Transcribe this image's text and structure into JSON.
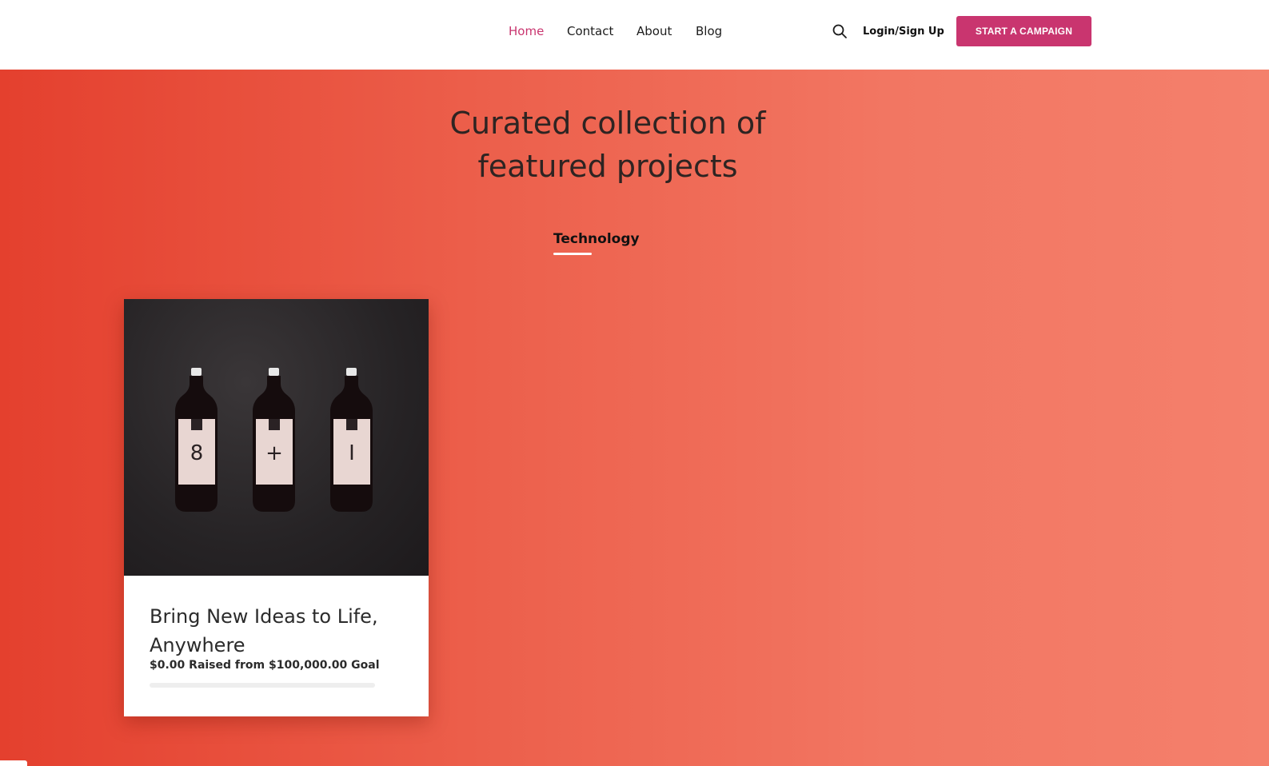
{
  "nav": {
    "items": [
      {
        "label": "Home",
        "active": true
      },
      {
        "label": "Contact",
        "active": false
      },
      {
        "label": "About",
        "active": false
      },
      {
        "label": "Blog",
        "active": false
      }
    ],
    "search_icon": "search-icon",
    "login_label": "Login/Sign Up",
    "cta_label": "START A CAMPAIGN"
  },
  "hero": {
    "title_line1": "Curated collection of",
    "title_line2": "featured projects",
    "category_tab": "Technology"
  },
  "card": {
    "image_alt": "Three dark bottles labeled 8, +, and I on a dark textured surface",
    "bottle_glyphs": [
      "8",
      "+",
      "I"
    ],
    "title": "Bring New Ideas to Life, Anywhere",
    "raised_text": "$0.00 Raised from $100,000.00 Goal",
    "progress_fraction": 0.0
  },
  "colors": {
    "accent": "#c9356f",
    "hero_gradient_start": "#e4402e",
    "hero_gradient_end": "#f4806c",
    "text_dark": "#2b2b2b"
  }
}
